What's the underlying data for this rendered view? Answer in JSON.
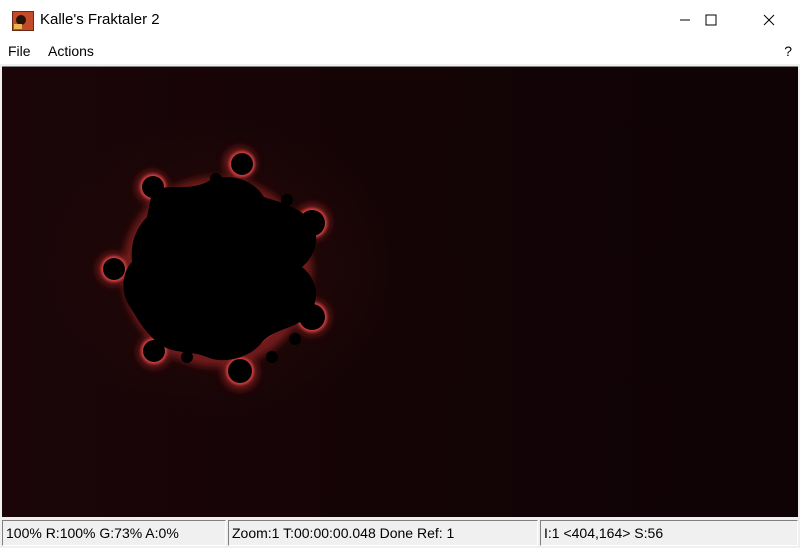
{
  "window": {
    "title": "Kalle's Fraktaler 2",
    "icon": "fractal-app-icon",
    "controls": [
      "minimize-icon",
      "maximize-icon",
      "close-icon"
    ]
  },
  "menu": {
    "file_label": "File",
    "actions_label": "Actions",
    "help_label": "?"
  },
  "canvas": {
    "description_icon": "mandelbrot-fractal",
    "background_color": "#140406",
    "glow_color": "#c83232"
  },
  "status": {
    "pane1": "100% R:100% G:73% A:0%",
    "pane2": "Zoom:1 T:00:00:00.048 Done Ref: 1",
    "pane3": "I:1 <404,164> S:56"
  }
}
